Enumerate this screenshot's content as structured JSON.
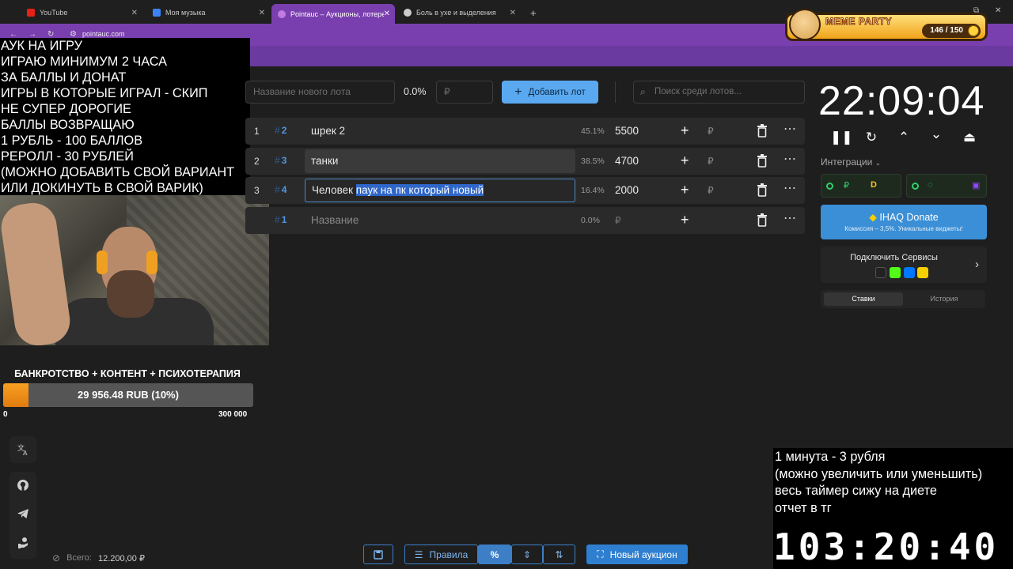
{
  "browser": {
    "tabs": [
      {
        "label": "YouTube",
        "color": "#e62117"
      },
      {
        "label": "Моя музыка",
        "color": "#3b82f6"
      },
      {
        "label": "Pointauc – Аукционы, лотереи",
        "color": "#9b59b6"
      },
      {
        "label": "Боль в ухе и выделения",
        "color": "#cccccc"
      }
    ],
    "new_tab": "+",
    "url": "pointauc.com"
  },
  "meme_party": {
    "title": "MEME PARTY",
    "counter": "146 / 150"
  },
  "stream_overlay": {
    "lines": [
      "АУК НА ИГРУ",
      "ИГРАЮ МИНИМУМ 2 ЧАСА",
      "ЗА БАЛЛЫ И ДОНАТ",
      "ИГРЫ В КОТОРЫЕ ИГРАЛ - СКИП",
      "НЕ СУПЕР ДОРОГИЕ",
      "БАЛЛЫ ВОЗВРАЩАЮ",
      "1 РУБЛЬ - 100 БАЛЛОВ",
      "РЕРОЛЛ - 30 РУБЛЕЙ",
      "(МОЖНО ДОБАВИТЬ СВОЙ ВАРИАНТ",
      "ИЛИ ДОКИНУТЬ В СВОЙ ВАРИК)"
    ]
  },
  "goal": {
    "title": "БАНКРОТСТВО + КОНТЕНТ + ПСИХОТЕРАПИЯ",
    "text": "29 956.48 RUB (10%)",
    "progress": 0.0999,
    "min": "0",
    "max": "300 000"
  },
  "controls": {
    "lot_placeholder": "Название нового лота",
    "percent": "0.0%",
    "price_placeholder": "₽",
    "add_button": "Добавить лот",
    "search_placeholder": "Поиск среди лотов..."
  },
  "lots": [
    {
      "num": "1",
      "id": "2",
      "name": "шрек 2",
      "pct": "45.1%",
      "amount": "5500"
    },
    {
      "num": "2",
      "id": "3",
      "name": "танки",
      "pct": "38.5%",
      "amount": "4700"
    },
    {
      "num": "3",
      "id": "4",
      "name_plain": "Человек ",
      "name_selected": "паук на пк который новый",
      "pct": "16.4%",
      "amount": "2000"
    },
    {
      "num": "",
      "id": "1",
      "name": "Название",
      "pct": "0.0%",
      "amount": "₽"
    }
  ],
  "hash": "#",
  "rub": "₽",
  "timer": "22:09:04",
  "integrations": {
    "label": "Интеграции"
  },
  "donate": {
    "title": "IHAQ Donate",
    "subtitle": "Комиссия – 3,5%. Уникальные виджеты!"
  },
  "services": {
    "title": "Подключить Сервисы"
  },
  "bets_tabs": {
    "active": "Ставки",
    "inactive": "История"
  },
  "bottom": {
    "rules": "Правила",
    "new_auction": "Новый аукцион",
    "total_label": "Всего:",
    "total_value": "12.200,00 ₽"
  },
  "overlay_br": {
    "lines": [
      "1 минута - 3 рубля",
      "(можно увеличить или уменьшить)",
      "весь таймер сижу на диете",
      "отчет в тг"
    ],
    "big_timer": "103:20:40"
  },
  "colors": {
    "accent": "#7a3fae",
    "button": "#5aa9f0",
    "id": "#4f97e0",
    "goal": "#f0901a"
  }
}
